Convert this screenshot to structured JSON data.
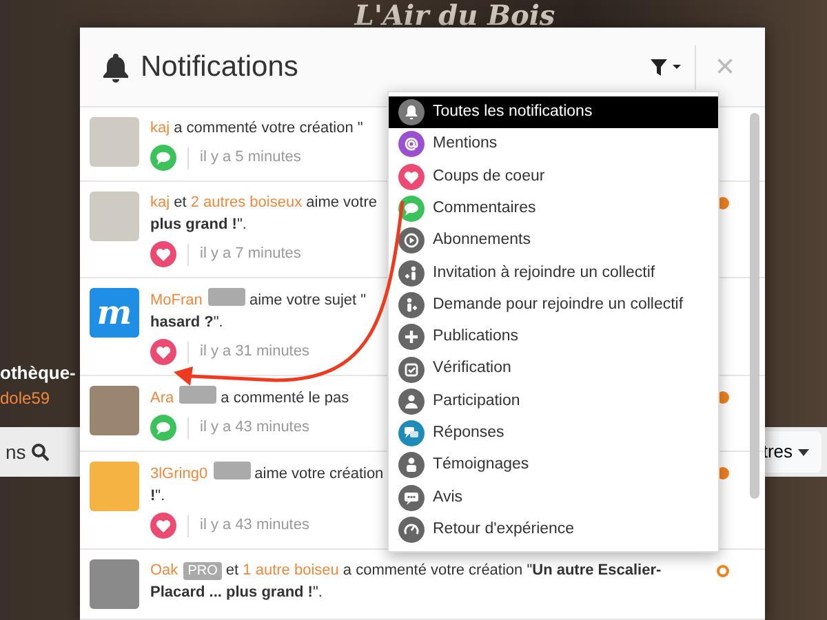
{
  "page": {
    "logo": "L'Air du Bois",
    "left_texts": [
      {
        "text": "othèque-",
        "kind": "title"
      },
      {
        "text": "dole59",
        "kind": "user"
      }
    ],
    "toolbar_left": "ns",
    "toolbar_right": "tres"
  },
  "modal": {
    "title": "Notifications",
    "close": "×"
  },
  "filter_menu": {
    "items": [
      {
        "label": "Toutes les notifications",
        "color": "#777777",
        "selected": true
      },
      {
        "label": "Mentions",
        "color": "#9b4fd1",
        "selected": false
      },
      {
        "label": "Coups de coeur",
        "color": "#ec4a72",
        "selected": false
      },
      {
        "label": "Commentaires",
        "color": "#3cc25a",
        "selected": false
      },
      {
        "label": "Abonnements",
        "color": "#666666",
        "selected": false
      },
      {
        "label": "Invitation à rejoindre un collectif",
        "color": "#666666",
        "selected": false
      },
      {
        "label": "Demande pour rejoindre un collectif",
        "color": "#666666",
        "selected": false
      },
      {
        "label": "Publications",
        "color": "#666666",
        "selected": false
      },
      {
        "label": "Vérification",
        "color": "#666666",
        "selected": false
      },
      {
        "label": "Participation",
        "color": "#666666",
        "selected": false
      },
      {
        "label": "Réponses",
        "color": "#1e8bb8",
        "selected": false
      },
      {
        "label": "Témoignages",
        "color": "#666666",
        "selected": false
      },
      {
        "label": "Avis",
        "color": "#666666",
        "selected": false
      },
      {
        "label": "Retour d'expérience",
        "color": "#666666",
        "selected": false
      }
    ]
  },
  "notifications": [
    {
      "avatar": {
        "color": "#cfcac2"
      },
      "lines": [
        [
          {
            "kind": "user",
            "text": "kaj"
          },
          {
            "kind": "text",
            "text": " a commenté votre création \""
          }
        ]
      ],
      "kind": "comment",
      "time": "il y a 5 minutes"
    },
    {
      "avatar": {
        "color": "#cfcac2"
      },
      "lines": [
        [
          {
            "kind": "user",
            "text": "kaj"
          },
          {
            "kind": "text",
            "text": " et "
          },
          {
            "kind": "user",
            "text": "2 autres boiseux"
          },
          {
            "kind": "text",
            "text": " aime votre"
          }
        ],
        [
          {
            "kind": "text",
            "text": "**plus grand !**\"."
          }
        ]
      ],
      "kind": "like",
      "time": "il y a 7 minutes",
      "dot": {
        "filled": true
      }
    },
    {
      "avatar": {
        "color": "#1f8fe6",
        "letter": "m"
      },
      "lines": [
        [
          {
            "kind": "user",
            "text": "MoFran"
          },
          {
            "kind": "saw-badge"
          },
          {
            "kind": "text",
            "text": " aime votre sujet \""
          }
        ],
        [
          {
            "kind": "text",
            "text": "**hasard ?**\"."
          }
        ]
      ],
      "kind": "like",
      "time": "il y a 31 minutes"
    },
    {
      "avatar": {
        "color": "#9a8670"
      },
      "lines": [
        [
          {
            "kind": "user",
            "text": "Ara"
          },
          {
            "kind": "saw-badge"
          },
          {
            "kind": "text",
            "text": " a commenté le pas"
          }
        ]
      ],
      "kind": "comment",
      "time": "il y a 43 minutes",
      "dot": {
        "filled": true
      }
    },
    {
      "avatar": {
        "color": "#f5b342"
      },
      "lines": [
        [
          {
            "kind": "user",
            "text": "3lGring0"
          },
          {
            "kind": "saw-badge"
          },
          {
            "kind": "text",
            "text": " aime votre création"
          }
        ],
        [
          {
            "kind": "text",
            "text": "**!**\"."
          }
        ]
      ],
      "kind": "like",
      "time": "il y a 43 minutes",
      "dot": {
        "filled": true
      }
    },
    {
      "avatar": {
        "color": "#8a8a8a"
      },
      "lines": [
        [
          {
            "kind": "user",
            "text": "Oak"
          },
          {
            "kind": "pro-badge",
            "text": "PRO"
          },
          {
            "kind": "text",
            "text": " et "
          },
          {
            "kind": "user",
            "text": "1 autre boiseu"
          },
          {
            "kind": "text",
            "text": " a commenté votre création \"**Un autre Escalier-**"
          }
        ],
        [
          {
            "kind": "text",
            "text": "**Placard ... plus grand !**\"."
          }
        ]
      ],
      "dot": {
        "filled": false
      }
    }
  ]
}
